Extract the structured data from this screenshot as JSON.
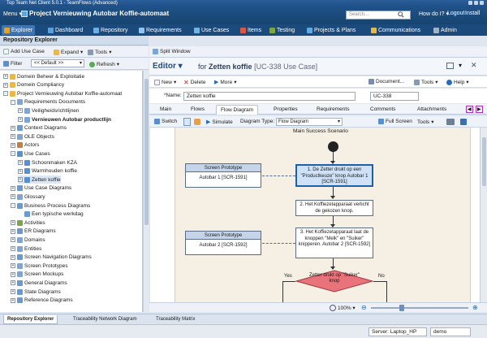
{
  "app": {
    "title": "Top Team Net Client 5.0.1 - TeamFlows (Advanced)",
    "menu_label": "Menu",
    "project_title": "Project Vernieuwing Autobar Koffie-automaat",
    "search_placeholder": "Search...",
    "how_do_i": "How do I?",
    "logout": "Logout",
    "install": "Install"
  },
  "nav_tabs": [
    {
      "label": "Explorer",
      "active": true,
      "color": "#e8a31d"
    },
    {
      "label": "Dashboard",
      "color": "#58a0e0"
    },
    {
      "label": "Repository",
      "color": "#6ab0e4"
    },
    {
      "label": "Requirements",
      "color": "#8fc4ee"
    },
    {
      "label": "Use Cases",
      "color": "#6fb6e8"
    },
    {
      "label": "Items",
      "color": "#d85a45"
    },
    {
      "label": "Testing",
      "color": "#7ea544"
    },
    {
      "label": "Projects & Plans",
      "color": "#60a9e3"
    },
    {
      "label": "Communications",
      "color": "#e8b845"
    },
    {
      "label": "Admin",
      "color": "#9fb2c8"
    }
  ],
  "left": {
    "header": "Repository Explorer",
    "add_use_case": "Add Use Case",
    "expand": "Expand",
    "tools": "Tools",
    "filter": "Filter",
    "default_filter": "<< Default >>",
    "refresh": "Refresh",
    "tree": [
      {
        "label": "Domein Beheer & Exploitatie",
        "level": 0,
        "exp": "+",
        "icon": "folder"
      },
      {
        "label": "Domein Compliancy",
        "level": 0,
        "exp": "+",
        "icon": "folder"
      },
      {
        "label": "Project Vernieuwing Autobar Koffie-automaat",
        "level": 0,
        "exp": "-",
        "icon": "folder"
      },
      {
        "label": "Requirements Documents",
        "level": 1,
        "exp": "-",
        "icon": "doc"
      },
      {
        "label": "Veiligheidsrichtlijnen",
        "level": 2,
        "exp": "+",
        "icon": "doc"
      },
      {
        "label": "Vernieuwen Autobar productlijn",
        "level": 2,
        "exp": "+",
        "icon": "doc",
        "bold": true
      },
      {
        "label": "Context Diagrams",
        "level": 1,
        "exp": "+",
        "icon": "diagram"
      },
      {
        "label": "OLE Objects",
        "level": 1,
        "exp": "+",
        "icon": "doc"
      },
      {
        "label": "Actors",
        "level": 1,
        "exp": "+",
        "icon": "actor"
      },
      {
        "label": "Use Cases",
        "level": 1,
        "exp": "-",
        "icon": "usecase"
      },
      {
        "label": "Schoonmaken KZA",
        "level": 2,
        "exp": "+",
        "icon": "usecase"
      },
      {
        "label": "Warmhouden koffie",
        "level": 2,
        "exp": "+",
        "icon": "usecase"
      },
      {
        "label": "Zetten koffie",
        "level": 2,
        "exp": "+",
        "icon": "usecase",
        "selected": true
      },
      {
        "label": "Use Case Diagrams",
        "level": 1,
        "exp": "+",
        "icon": "diagram"
      },
      {
        "label": "Glossary",
        "level": 1,
        "exp": "+",
        "icon": "doc"
      },
      {
        "label": "Business Process Diagrams",
        "level": 1,
        "exp": "-",
        "icon": "diagram"
      },
      {
        "label": "Een typische werkdag",
        "level": 2,
        "exp": "",
        "icon": "diagram"
      },
      {
        "label": "Activities",
        "level": 1,
        "exp": "+",
        "icon": "activity"
      },
      {
        "label": "ER Diagrams",
        "level": 1,
        "exp": "+",
        "icon": "diagram"
      },
      {
        "label": "Domains",
        "level": 1,
        "exp": "+",
        "icon": "doc"
      },
      {
        "label": "Entities",
        "level": 1,
        "exp": "+",
        "icon": "doc"
      },
      {
        "label": "Screen Navigation Diagrams",
        "level": 1,
        "exp": "+",
        "icon": "diagram"
      },
      {
        "label": "Screen Prototypes",
        "level": 1,
        "exp": "+",
        "icon": "doc"
      },
      {
        "label": "Screen Mockups",
        "level": 1,
        "exp": "+",
        "icon": "doc"
      },
      {
        "label": "General Diagrams",
        "level": 1,
        "exp": "+",
        "icon": "diagram"
      },
      {
        "label": "State Diagrams",
        "level": 1,
        "exp": "+",
        "icon": "diagram"
      },
      {
        "label": "Reference Diagrams",
        "level": 1,
        "exp": "+",
        "icon": "diagram"
      }
    ]
  },
  "right": {
    "split_window": "Split Window",
    "editor_label": "Editor",
    "editor_for": "for",
    "item_name": "Zetten koffie",
    "item_code": "[UC-338 Use Case]",
    "toolbar": {
      "new": "New",
      "delete": "Delete",
      "more": "More",
      "document": "Document...",
      "tools": "Tools",
      "help": "Help"
    },
    "name_label": "*Name:",
    "name_value": "Zetten koffie",
    "id_value": "UC-338",
    "tabs": [
      "Main",
      "Flows",
      "Flow Diagram",
      "Properties",
      "Requirements",
      "Comments",
      "Attachments"
    ],
    "active_tab": "Flow Diagram",
    "diagram_toolbar": {
      "switch": "Switch",
      "simulate": "Simulate",
      "diagram_type_label": "Diagram Type:",
      "diagram_type": "Flow Diagram",
      "full_screen": "Full Screen",
      "tools": "Tools"
    },
    "diagram": {
      "title": "Main Success Scenario",
      "prototype1_header": "Screen Prototype",
      "prototype1_body": "Autobar 1 [SCR-1591]",
      "prototype2_header": "Screen Prototype",
      "prototype2_body": "Autobar 2 [SCR-1592]",
      "step1": "1. De Zetter drukt op een \"Productkeuze\" knop Autobar 1 [SCR-1591]",
      "step2": "2. Het Koffiezetapparaat verlicht de gekozen knop.",
      "step3": "3. Het Koffiezetapparaat laat de knoppen \"Melk\" en \"Suiker\" knipperen. Autobar 2 [SCR-1592]",
      "decision": "Zetter drukt op \"Suiker\" knop",
      "yes": "Yes",
      "no": "No"
    },
    "zoom": "100%"
  },
  "bottom_tabs": [
    "Repository Explorer",
    "Traceability Network Diagram",
    "Traceability Matrix"
  ],
  "status": {
    "server": "Server: Laptop_HP",
    "user": "demo"
  }
}
